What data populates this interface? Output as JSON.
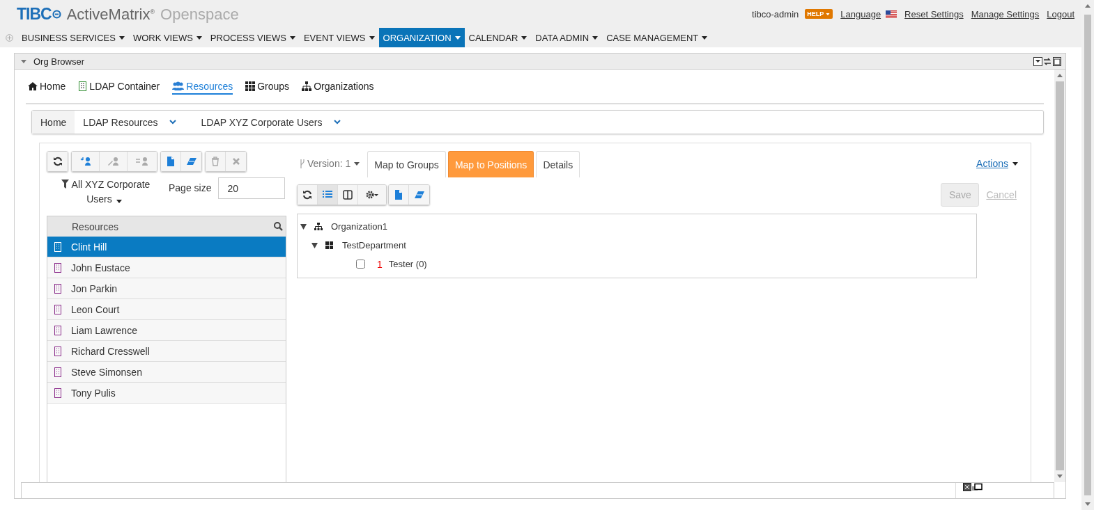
{
  "header": {
    "brand": "TIBC",
    "product": "ActiveMatrix",
    "product_mark": "®",
    "suffix": "Openspace",
    "user": "tibco-admin",
    "help": "HELP",
    "links": [
      "Language",
      "Reset Settings",
      "Manage Settings",
      "Logout"
    ]
  },
  "nav": [
    {
      "label": "BUSINESS SERVICES",
      "selected": false
    },
    {
      "label": "WORK VIEWS",
      "selected": false
    },
    {
      "label": "PROCESS VIEWS",
      "selected": false
    },
    {
      "label": "EVENT VIEWS",
      "selected": false
    },
    {
      "label": "ORGANIZATION",
      "selected": true
    },
    {
      "label": "CALENDAR",
      "selected": false
    },
    {
      "label": "DATA ADMIN",
      "selected": false
    },
    {
      "label": "CASE MANAGEMENT",
      "selected": false
    }
  ],
  "gadget": {
    "title": "Org Browser"
  },
  "org_tabs": [
    {
      "label": "Home",
      "kind": "home",
      "selected": false
    },
    {
      "label": "LDAP Container",
      "kind": "building",
      "selected": false
    },
    {
      "label": "Resources",
      "kind": "users",
      "selected": true
    },
    {
      "label": "Groups",
      "kind": "grid",
      "selected": false
    },
    {
      "label": "Organizations",
      "kind": "sitemap",
      "selected": false
    }
  ],
  "breadcrumb": [
    {
      "label": "Home",
      "dropdown": false
    },
    {
      "label": "LDAP Resources",
      "dropdown": true
    },
    {
      "label": "LDAP XYZ Corporate Users",
      "dropdown": true
    }
  ],
  "filter": {
    "label": "All XYZ Corporate Users"
  },
  "page_size": {
    "label": "Page size",
    "value": "20"
  },
  "resources": {
    "heading": "Resources",
    "rows": [
      {
        "name": "Clint Hill",
        "selected": true
      },
      {
        "name": "John Eustace",
        "selected": false
      },
      {
        "name": "Jon Parkin",
        "selected": false
      },
      {
        "name": "Leon Court",
        "selected": false
      },
      {
        "name": "Liam Lawrence",
        "selected": false
      },
      {
        "name": "Richard Cresswell",
        "selected": false
      },
      {
        "name": "Steve Simonsen",
        "selected": false
      },
      {
        "name": "Tony Pulis",
        "selected": false
      }
    ]
  },
  "version": "Version: 1",
  "detail_tabs": [
    {
      "label": "Map to Groups",
      "selected": false
    },
    {
      "label": "Map to Positions",
      "selected": true
    },
    {
      "label": "Details",
      "selected": false
    }
  ],
  "actions": "Actions",
  "save": {
    "label": "Save",
    "disabled": true
  },
  "cancel": {
    "label": "Cancel",
    "disabled": true
  },
  "tree": [
    {
      "label": "Organization1",
      "kind": "organization",
      "expanded": true,
      "children": [
        {
          "label": "TestDepartment",
          "kind": "department",
          "expanded": true,
          "children": [
            {
              "label": "Tester (0)",
              "kind": "position",
              "count": "1",
              "checked": false
            }
          ]
        }
      ]
    }
  ]
}
